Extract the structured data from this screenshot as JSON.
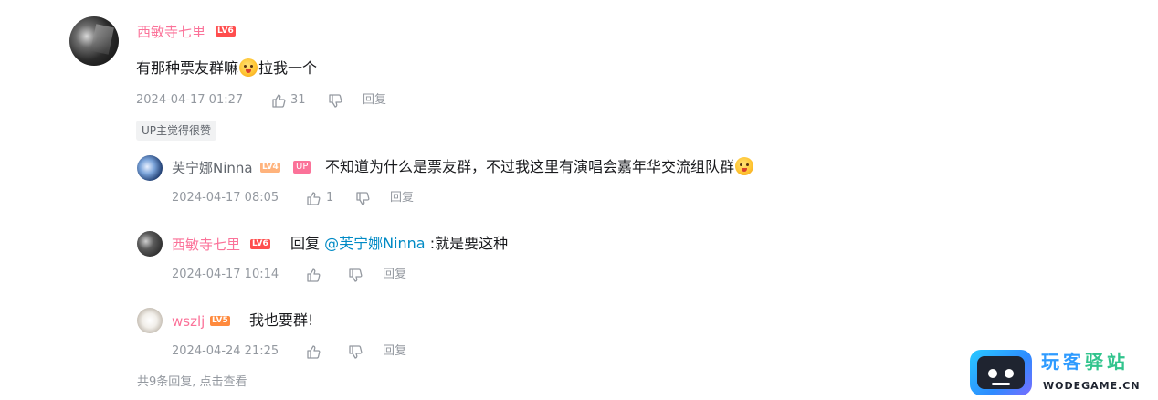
{
  "main_comment": {
    "username": "西敏寺七里",
    "level": "LV6",
    "content_before_emoji": "有那种票友群嘛",
    "content_after_emoji": "拉我一个",
    "emoji": "shocked-emoji",
    "date": "2024-04-17 01:27",
    "like_count": "31",
    "reply_label": "回复",
    "up_liked_badge": "UP主觉得很赞"
  },
  "replies": [
    {
      "username": "芙宁娜Ninna",
      "level": "LV4",
      "up_tag": "UP",
      "content": "不知道为什么是票友群，不过我这里有演唱会嘉年华交流组队群",
      "emoji": "grinning-emoji",
      "date": "2024-04-17 08:05",
      "like_count": "1",
      "reply_label": "回复"
    },
    {
      "username": "西敏寺七里",
      "level": "LV6",
      "reply_prefix": "回复",
      "mention": "@芙宁娜Ninna",
      "content": ":就是要这种",
      "date": "2024-04-17 10:14",
      "like_count": "",
      "reply_label": "回复"
    },
    {
      "username": "wszlj",
      "level": "LV5",
      "content": "我也要群!",
      "date": "2024-04-24 21:25",
      "like_count": "",
      "reply_label": "回复"
    }
  ],
  "footer": {
    "total_replies": "共9条回复,",
    "view_link": "点击查看"
  },
  "watermark": {
    "title_part1": "玩客",
    "title_part2": "驿站",
    "domain": "WODEGAME.CN"
  },
  "colors": {
    "vip_name": "#fb7299",
    "mention": "#008ac5",
    "meta": "#9499a0",
    "lv6": "#ff4d4d",
    "lv4": "#ffb37c",
    "lv5": "#ff8a3d"
  }
}
